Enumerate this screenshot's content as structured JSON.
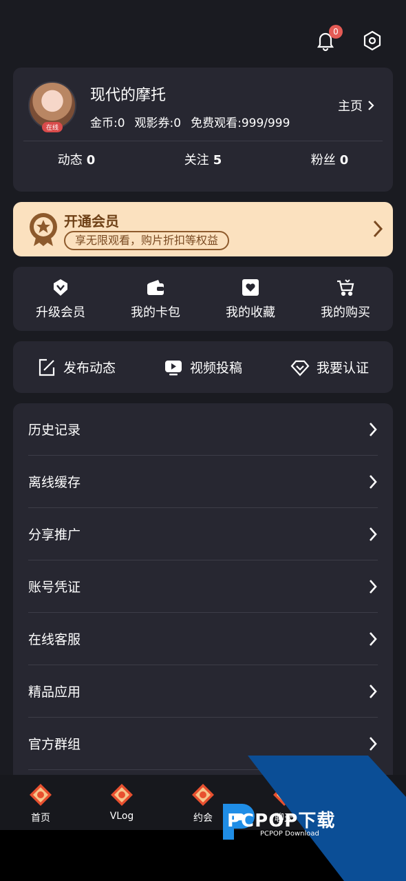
{
  "header": {
    "notification_badge": "0",
    "icons": [
      "bell-icon",
      "settings-icon"
    ]
  },
  "profile": {
    "username": "现代的摩托",
    "online_tag": "在线",
    "coins": "金币:0",
    "tickets": "观影券:0",
    "free_views": "免费观看:999/999",
    "homepage_label": "主页",
    "counts": [
      {
        "label": "动态",
        "value": "0"
      },
      {
        "label": "关注",
        "value": "5"
      },
      {
        "label": "粉丝",
        "value": "0"
      }
    ]
  },
  "vip": {
    "title": "开通会员",
    "subtitle": "享无限观看，购片折扣等权益",
    "accent": "#fbe1bf"
  },
  "quick": [
    {
      "label": "升级会员",
      "icon": "vip-badge-icon"
    },
    {
      "label": "我的卡包",
      "icon": "wallet-icon"
    },
    {
      "label": "我的收藏",
      "icon": "favorites-icon"
    },
    {
      "label": "我的购买",
      "icon": "cart-icon"
    }
  ],
  "actions": [
    {
      "label": "发布动态",
      "icon": "edit-icon"
    },
    {
      "label": "视频投稿",
      "icon": "video-icon"
    },
    {
      "label": "我要认证",
      "icon": "diamond-icon"
    }
  ],
  "menu": [
    {
      "label": "历史记录"
    },
    {
      "label": "离线缓存"
    },
    {
      "label": "分享推广"
    },
    {
      "label": "账号凭证"
    },
    {
      "label": "在线客服"
    },
    {
      "label": "精品应用"
    },
    {
      "label": "官方群组"
    }
  ],
  "tabs": [
    {
      "label": "首页"
    },
    {
      "label": "VLog"
    },
    {
      "label": "约会"
    },
    {
      "label": "聊天"
    }
  ],
  "watermark": {
    "brand": "PCPOP下载",
    "sub": "PCPOP Download"
  }
}
